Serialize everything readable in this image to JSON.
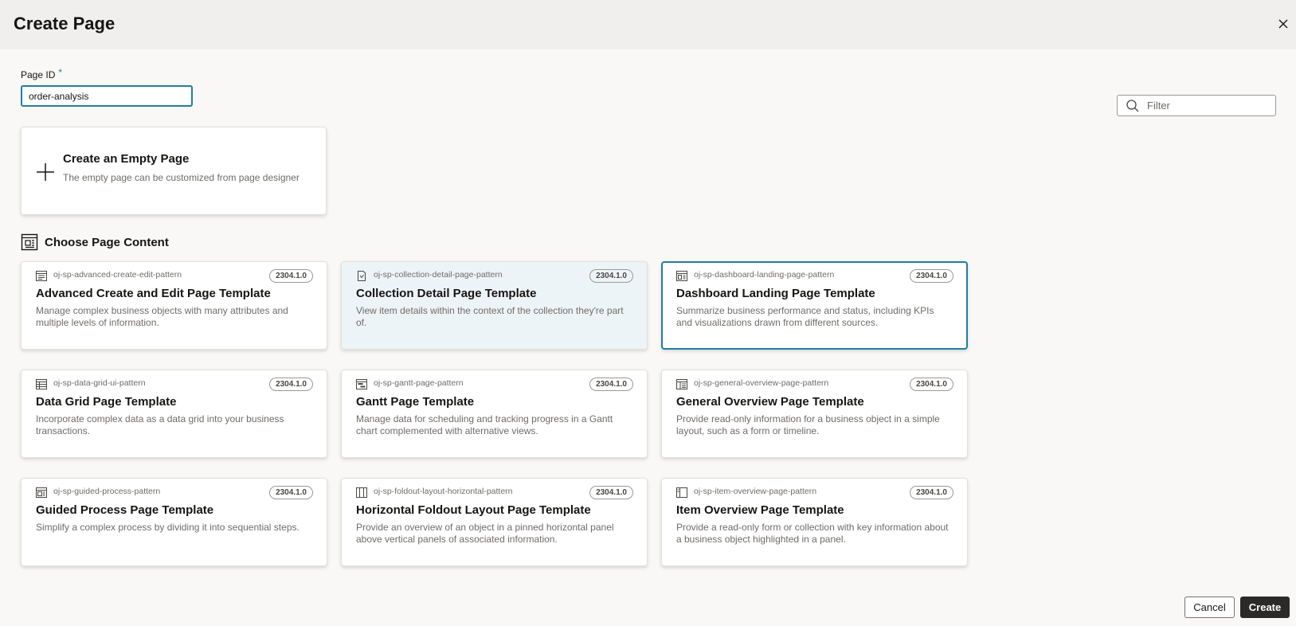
{
  "dialog": {
    "title": "Create Page"
  },
  "page_id": {
    "label": "Page ID",
    "required_marker": "*",
    "value": "order-analysis"
  },
  "filter": {
    "placeholder": "Filter"
  },
  "empty_page": {
    "title": "Create an Empty Page",
    "description": "The empty page can be customized from page designer"
  },
  "section": {
    "title": "Choose Page Content"
  },
  "templates": [
    {
      "id": "oj-sp-advanced-create-edit-pattern",
      "version": "2304.1.0",
      "title": "Advanced Create and Edit Page Template",
      "description": "Manage complex business objects with many attributes and multiple levels of information.",
      "icon": "form-icon",
      "state": "normal"
    },
    {
      "id": "oj-sp-collection-detail-page-pattern",
      "version": "2304.1.0",
      "title": "Collection Detail Page Template",
      "description": "View item details within the context of the collection they're part of.",
      "icon": "document-icon",
      "state": "hovered"
    },
    {
      "id": "oj-sp-dashboard-landing-page-pattern",
      "version": "2304.1.0",
      "title": "Dashboard Landing Page Template",
      "description": "Summarize business performance and status, including KPIs and visualizations drawn from different sources.",
      "icon": "dashboard-icon",
      "state": "selected"
    },
    {
      "id": "oj-sp-data-grid-ui-pattern",
      "version": "2304.1.0",
      "title": "Data Grid Page Template",
      "description": "Incorporate complex data as a data grid into your business transactions.",
      "icon": "grid-icon",
      "state": "normal"
    },
    {
      "id": "oj-sp-gantt-page-pattern",
      "version": "2304.1.0",
      "title": "Gantt Page Template",
      "description": "Manage data for scheduling and tracking progress in a Gantt chart complemented with alternative views.",
      "icon": "gantt-icon",
      "state": "normal"
    },
    {
      "id": "oj-sp-general-overview-page-pattern",
      "version": "2304.1.0",
      "title": "General Overview Page Template",
      "description": "Provide read-only information for a business object in a simple layout, such as a form or timeline.",
      "icon": "overview-icon",
      "state": "normal"
    },
    {
      "id": "oj-sp-guided-process-pattern",
      "version": "2304.1.0",
      "title": "Guided Process Page Template",
      "description": "Simplify a complex process by dividing it into sequential steps.",
      "icon": "process-icon",
      "state": "normal"
    },
    {
      "id": "oj-sp-foldout-layout-horizontal-pattern",
      "version": "2304.1.0",
      "title": "Horizontal Foldout Layout Page Template",
      "description": "Provide an overview of an object in a pinned horizontal panel above vertical panels of associated information.",
      "icon": "foldout-icon",
      "state": "normal"
    },
    {
      "id": "oj-sp-item-overview-page-pattern",
      "version": "2304.1.0",
      "title": "Item Overview Page Template",
      "description": "Provide a read-only form or collection with key information about a business object highlighted in a panel.",
      "icon": "item-overview-icon",
      "state": "normal"
    }
  ],
  "buttons": {
    "cancel": "Cancel",
    "create": "Create"
  },
  "colors": {
    "accent": "#227e9e",
    "create_button": "#2c2a28",
    "hover_card": "#edf4f7"
  }
}
